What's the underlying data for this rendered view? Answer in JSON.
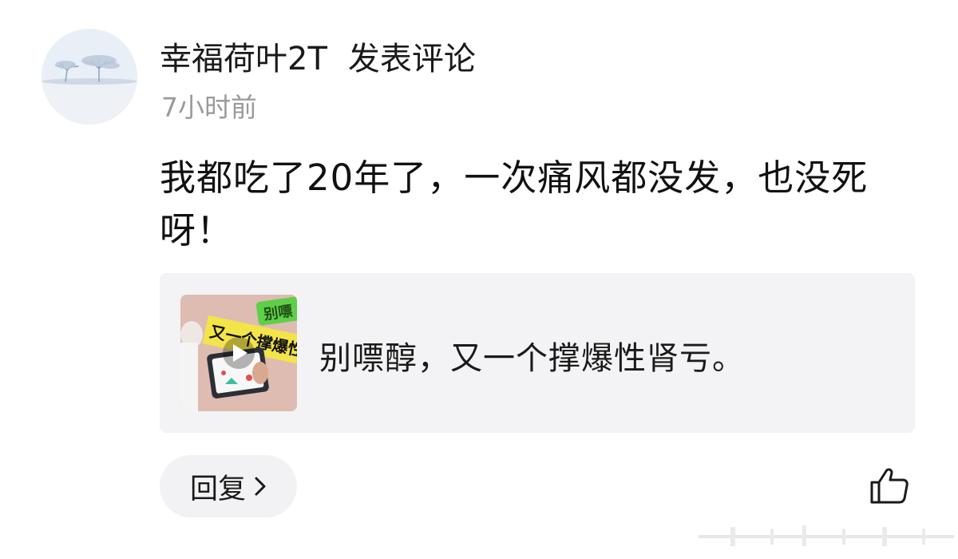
{
  "author": {
    "name": "幸福荷叶2T",
    "action": "发表评论",
    "timestamp": "7小时前"
  },
  "comment": {
    "text": "我都吃了20年了，一次痛风都没发，也没死呀！"
  },
  "shared_video": {
    "title": "别嘌醇，又一个撑爆性肾亏。",
    "thumbnail_overlay_text": "别嘌醇 又一个撑爆性"
  },
  "actions": {
    "reply_label": "回复",
    "icons": [
      "chevron-right-icon",
      "thumbs-up-icon",
      "play-icon"
    ]
  },
  "colors": {
    "card_background": "#f3f3f5",
    "secondary_text": "#9a9a9a",
    "button_background": "#f2f2f4"
  }
}
